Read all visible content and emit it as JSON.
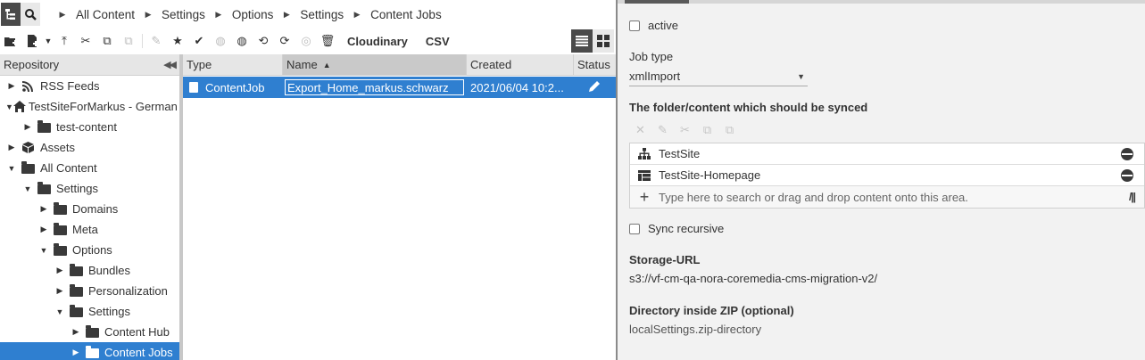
{
  "breadcrumb": {
    "items": [
      "All Content",
      "Settings",
      "Options",
      "Settings",
      "Content Jobs"
    ]
  },
  "toolbar": {
    "cloudinary_label": "Cloudinary",
    "csv_label": "CSV"
  },
  "repository": {
    "title": "Repository",
    "tree": [
      {
        "label": "RSS Feeds",
        "expanded": false,
        "icon": "rss-icon"
      },
      {
        "label": "TestSiteForMarkus - German (Germany)",
        "expanded": true,
        "icon": "home-icon"
      },
      {
        "label": "test-content",
        "expanded": false,
        "icon": "folder-icon"
      },
      {
        "label": "Assets",
        "expanded": false,
        "icon": "cube-icon"
      },
      {
        "label": "All Content",
        "expanded": true,
        "icon": "folder-icon"
      },
      {
        "label": "Settings",
        "expanded": true,
        "icon": "folder-icon"
      },
      {
        "label": "Domains",
        "expanded": false,
        "icon": "folder-icon"
      },
      {
        "label": "Meta",
        "expanded": false,
        "icon": "folder-icon"
      },
      {
        "label": "Options",
        "expanded": true,
        "icon": "folder-icon"
      },
      {
        "label": "Bundles",
        "expanded": false,
        "icon": "folder-icon"
      },
      {
        "label": "Personalization",
        "expanded": false,
        "icon": "folder-icon"
      },
      {
        "label": "Settings",
        "expanded": true,
        "icon": "folder-icon"
      },
      {
        "label": "Content Hub",
        "expanded": false,
        "icon": "folder-icon"
      },
      {
        "label": "Content Jobs",
        "expanded": false,
        "icon": "folder-icon",
        "selected": true
      }
    ]
  },
  "grid": {
    "columns": [
      "Type",
      "Name",
      "Created",
      "Status"
    ],
    "sorted_column": "Name",
    "rows": [
      {
        "type": "ContentJob",
        "name": "Export_Home_markus.schwarz",
        "created": "2021/06/04 10:2...",
        "status_icon": "pencil-icon"
      }
    ]
  },
  "form": {
    "active_label": "active",
    "active_checked": false,
    "job_type_label": "Job type",
    "job_type_value": "xmlImport",
    "sync_label": "The folder/content which should be synced",
    "linked_items": [
      {
        "label": "TestSite",
        "icon": "sitemap-icon"
      },
      {
        "label": "TestSite-Homepage",
        "icon": "page-grid-icon"
      }
    ],
    "search_placeholder": "Type here to search or drag and drop content onto this area.",
    "sync_recursive_label": "Sync recursive",
    "sync_recursive_checked": false,
    "storage_url_label": "Storage-URL",
    "storage_url_value": "s3://vf-cm-qa-nora-coremedia-cms-migration-v2/",
    "zip_dir_label": "Directory inside ZIP (optional)",
    "zip_dir_value": "localSettings.zip-directory"
  },
  "colors": {
    "selection": "#2f7fd0",
    "panel_bg": "#f2f2f2",
    "header_bg": "#e6e6e6"
  }
}
